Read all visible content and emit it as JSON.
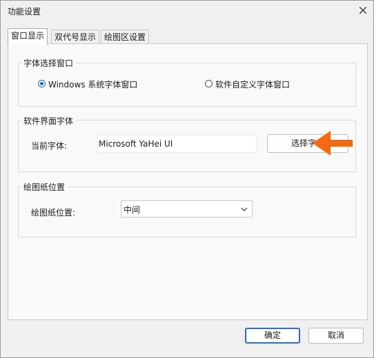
{
  "window": {
    "title": "功能设置"
  },
  "tabs": [
    {
      "label": "窗口显示",
      "active": true
    },
    {
      "label": "双代号显示",
      "active": false
    },
    {
      "label": "绘图区设置",
      "active": false
    }
  ],
  "font_window_group": {
    "title": "字体选择窗口",
    "option_windows": "Windows 系统字体窗口",
    "option_custom": "软件自定义字体窗口",
    "selected": "option_windows"
  },
  "ui_font_group": {
    "title": "软件界面字体",
    "current_label": "当前字体:",
    "current_value": "Microsoft YaHei UI",
    "choose_button": "选择字体"
  },
  "paper_group": {
    "title": "绘图纸位置",
    "label": "绘图纸位置:",
    "selected": "中间"
  },
  "footer": {
    "ok": "确定",
    "cancel": "取消"
  },
  "colors": {
    "accent": "#1a63c9",
    "arrow": "#f36a10"
  }
}
